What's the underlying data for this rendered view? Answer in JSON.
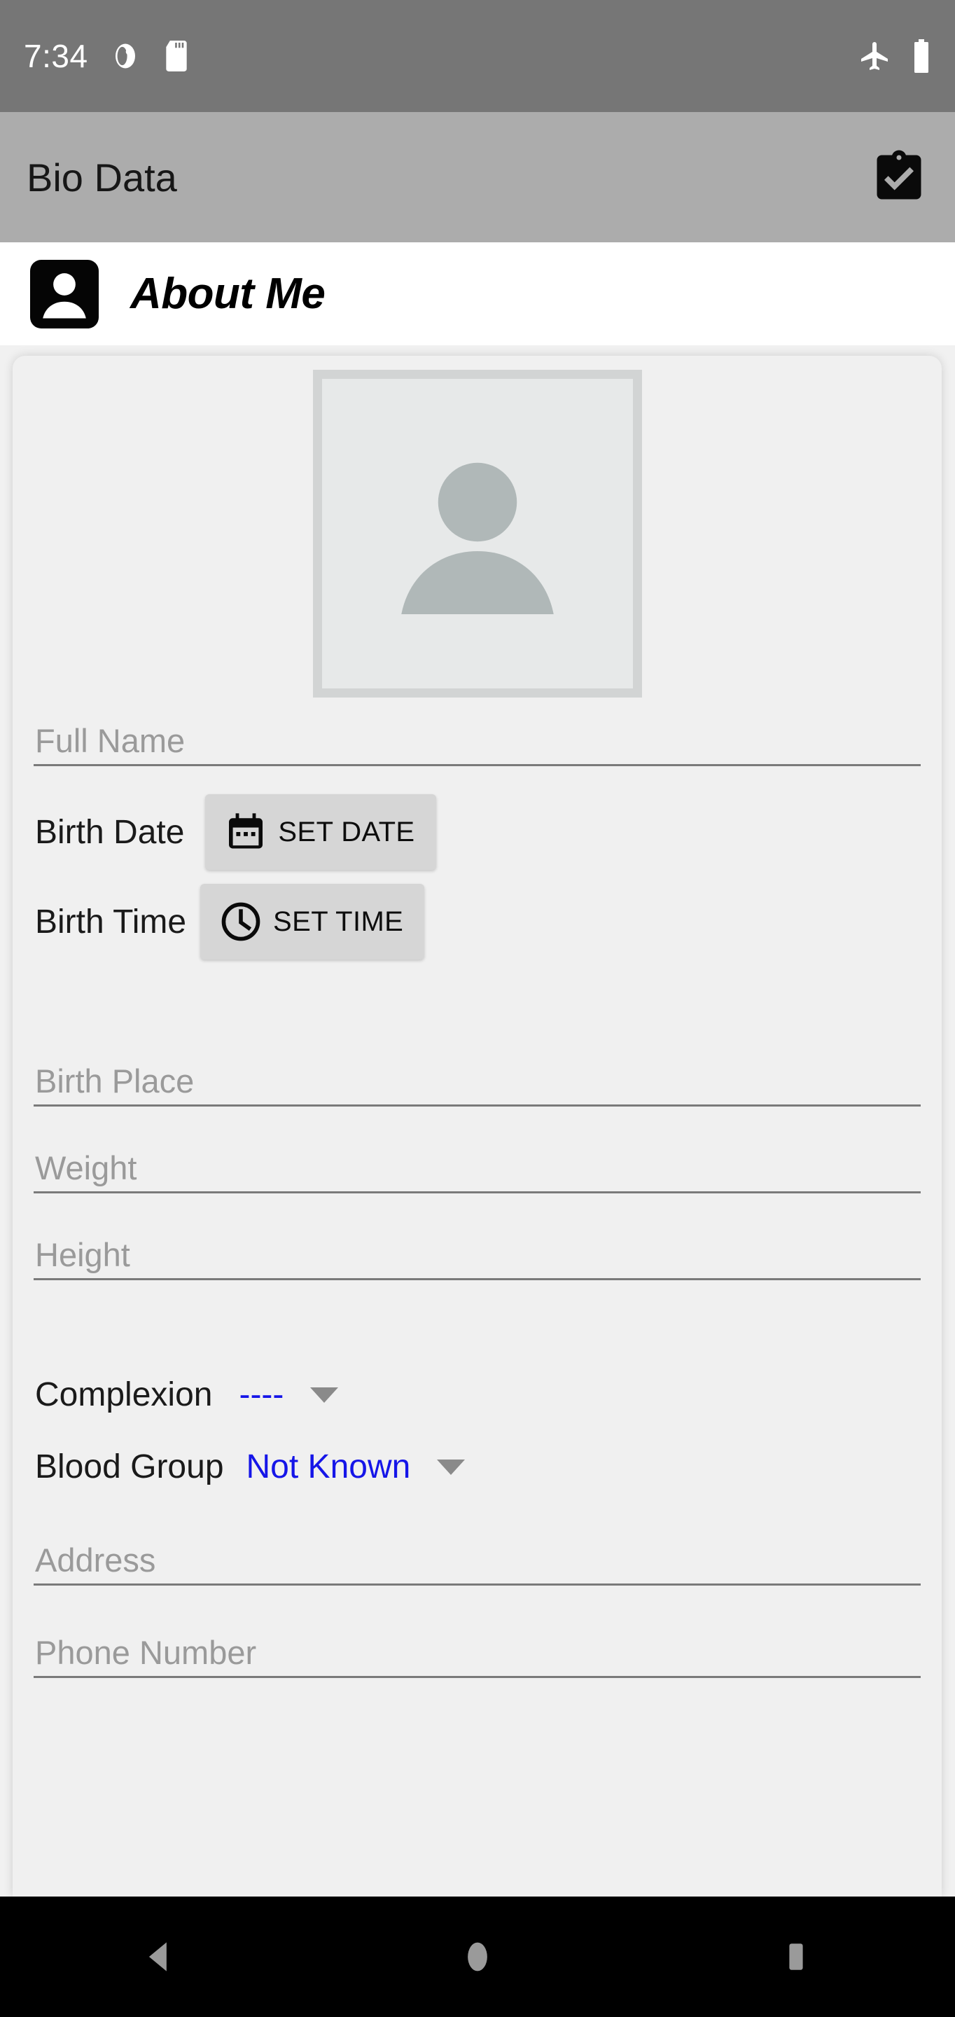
{
  "status_bar": {
    "time": "7:34",
    "icons": [
      "data-saver-icon",
      "sd-card-icon"
    ],
    "right_icons": [
      "airplane-mode-icon",
      "battery-full-icon"
    ],
    "background": "#767676"
  },
  "app_bar": {
    "title": "Bio Data",
    "background": "#acacac",
    "action_icon": "clipboard-check-icon"
  },
  "section_header": {
    "title": "About Me",
    "icon": "account-box-icon",
    "background": "#ffffff"
  },
  "form": {
    "avatar": {
      "icon": "person-placeholder-icon",
      "frame_color": "#d2d4d4",
      "inner_color": "#e7e9e9",
      "silhouette_color": "#b0b8b8"
    },
    "fields": {
      "full_name": {
        "label": "Full Name",
        "placeholder": "Full Name",
        "value": ""
      },
      "birth_date": {
        "label": "Birth Date",
        "button_label": "SET DATE",
        "button_icon": "calendar-icon",
        "value": ""
      },
      "birth_time": {
        "label": "Birth Time",
        "button_label": "SET TIME",
        "button_icon": "clock-icon",
        "value": ""
      },
      "birth_place": {
        "label": "Birth Place",
        "placeholder": "Birth Place",
        "value": ""
      },
      "weight": {
        "label": "Weight",
        "placeholder": "Weight",
        "value": ""
      },
      "height": {
        "label": "Height",
        "placeholder": "Height",
        "value": ""
      },
      "complexion": {
        "label": "Complexion",
        "selected": "----"
      },
      "blood_group": {
        "label": "Blood Group",
        "selected": "Not Known"
      },
      "address": {
        "label": "Address",
        "placeholder": "Address",
        "value": ""
      },
      "phone_number": {
        "label": "Phone Number",
        "placeholder": "Phone Number",
        "value": ""
      }
    },
    "accent_color": "#1515e8",
    "underline_color": "#7a7a7a",
    "button_background": "#d6d6d6",
    "card_background": "#f0f0f0"
  },
  "nav_bar": {
    "background": "#000000",
    "buttons": [
      "back-button",
      "home-button",
      "recents-button"
    ],
    "icon_color": "#9a9a9a"
  }
}
